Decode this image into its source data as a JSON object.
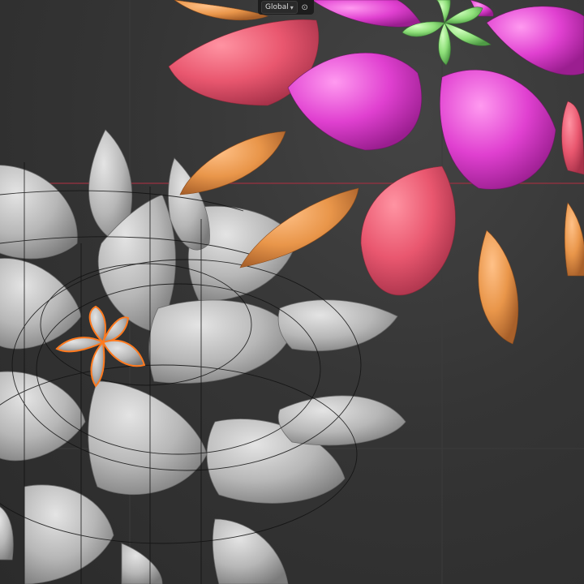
{
  "header": {
    "orientation_label": "Global",
    "orientation_icon": "chevron-down-icon",
    "snap_icon": "snap-toggle-icon"
  },
  "scene": {
    "palette": {
      "pink": "#e9576f",
      "magenta": "#e040d0",
      "orange": "#e9964a",
      "green": "#8fe07a",
      "gray": "#b7b7b7",
      "selection": "#ff7a1f",
      "axis_x": "#9a3140"
    }
  }
}
